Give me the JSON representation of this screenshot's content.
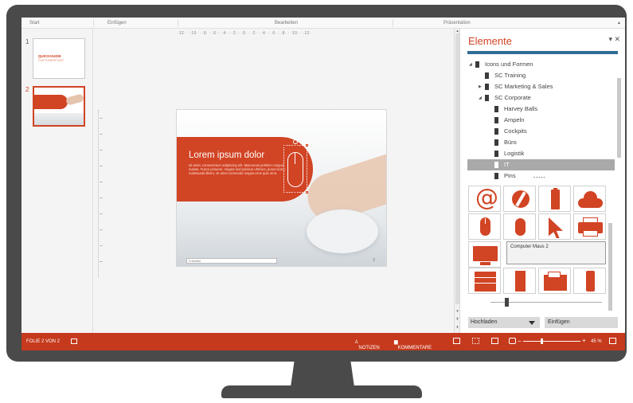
{
  "ribbon": {
    "groups": [
      "Start",
      "Einfügen",
      "Bearbeiten",
      "Präsentation"
    ]
  },
  "thumbnails": {
    "items": [
      {
        "number": "1",
        "title": "QUICKGUIDE",
        "subtitle": "FÜR POWERPOINT"
      },
      {
        "number": "2"
      }
    ]
  },
  "ruler": {
    "horizontal": "·12· · ·10· · ·8· · ·6· · ·4· · ·2· · ·0· · ·2· · ·4· · ·6· · ·8· · ·10· · ·12·"
  },
  "slide": {
    "title": "Lorem ipsum dolor",
    "body": "sit amet, consectetuer adipiscing elit. Maecenas porttitor congue massa. Fusce posuere, magna sed pulvinar ultricies, purus lectus malesuada libero, sit amet commodo magna eros quis urna.",
    "footer": "Fußzeile",
    "page_number": "2"
  },
  "pane": {
    "title": "Elemente",
    "controls": "▾ ✕",
    "tree": [
      {
        "label": "Icons und Formen",
        "arrow": "◢"
      },
      {
        "label": "SC Training",
        "arrow": ""
      },
      {
        "label": "SC Marketing & Sales",
        "arrow": "▶"
      },
      {
        "label": "SC Corporate",
        "arrow": "◢"
      },
      {
        "label": "Harvey Balls",
        "arrow": ""
      },
      {
        "label": "Ampeln",
        "arrow": ""
      },
      {
        "label": "Cockpits",
        "arrow": ""
      },
      {
        "label": "Büro",
        "arrow": ""
      },
      {
        "label": "Logistik",
        "arrow": ""
      },
      {
        "label": "IT",
        "arrow": ""
      },
      {
        "label": "Pins",
        "arrow": ""
      }
    ],
    "selected_index": 9,
    "gallery": {
      "icons": [
        "at-sign-icon",
        "flash-icon",
        "usb-stick-icon",
        "cloud-icon",
        "computer-mouse-icon",
        "mouse-icon",
        "cursor-arrow-icon",
        "printer-icon",
        "monitor-icon",
        "server-rack-icon",
        "pc-tower-icon",
        "fax-icon",
        "smartphone-icon"
      ],
      "selected_label": "Computer Maus 2"
    },
    "upload_label": "Hochladen",
    "insert_label": "Einfügen"
  },
  "status": {
    "slide_info": "FOLIE 2 VON 2",
    "notes": "NOTIZEN",
    "comments": "KOMMENTARE",
    "zoom": "45 %"
  },
  "colors": {
    "accent": "#d14424",
    "status_bar": "#c5391c",
    "pane_bar": "#2f6d94",
    "bezel": "#4a4a4a"
  }
}
